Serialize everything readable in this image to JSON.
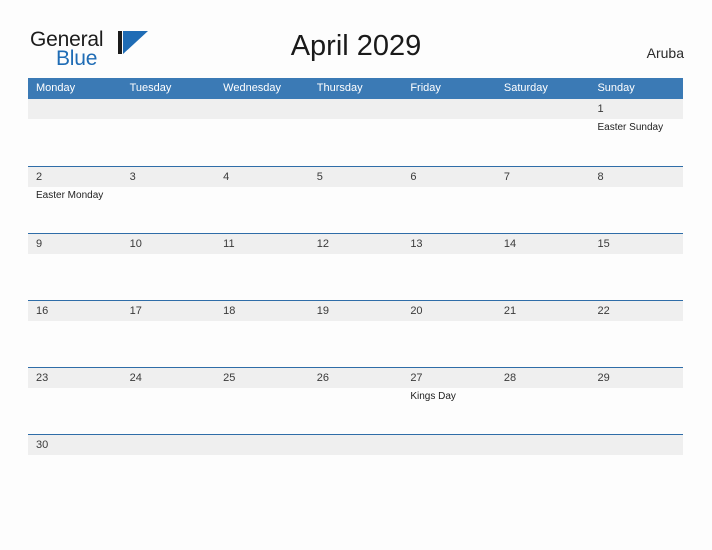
{
  "brand": {
    "word_one": "General",
    "word_two": "Blue",
    "mark_icon": "flag-triangle-icon",
    "accent_color": "#1f6cb5"
  },
  "header": {
    "title": "April 2029",
    "region": "Aruba"
  },
  "colors": {
    "header_blue": "#3b7ab5",
    "row_divider_blue": "#2f6da8",
    "date_band_gray": "#efefef",
    "page_background": "#fdfdfd"
  },
  "calendar": {
    "month": "April",
    "year": "2029",
    "weekday_headers": [
      "Monday",
      "Tuesday",
      "Wednesday",
      "Thursday",
      "Friday",
      "Saturday",
      "Sunday"
    ],
    "weeks": [
      {
        "days": [
          {
            "date": "",
            "event": ""
          },
          {
            "date": "",
            "event": ""
          },
          {
            "date": "",
            "event": ""
          },
          {
            "date": "",
            "event": ""
          },
          {
            "date": "",
            "event": ""
          },
          {
            "date": "",
            "event": ""
          },
          {
            "date": "1",
            "event": "Easter Sunday"
          }
        ]
      },
      {
        "days": [
          {
            "date": "2",
            "event": "Easter Monday"
          },
          {
            "date": "3",
            "event": ""
          },
          {
            "date": "4",
            "event": ""
          },
          {
            "date": "5",
            "event": ""
          },
          {
            "date": "6",
            "event": ""
          },
          {
            "date": "7",
            "event": ""
          },
          {
            "date": "8",
            "event": ""
          }
        ]
      },
      {
        "days": [
          {
            "date": "9",
            "event": ""
          },
          {
            "date": "10",
            "event": ""
          },
          {
            "date": "11",
            "event": ""
          },
          {
            "date": "12",
            "event": ""
          },
          {
            "date": "13",
            "event": ""
          },
          {
            "date": "14",
            "event": ""
          },
          {
            "date": "15",
            "event": ""
          }
        ]
      },
      {
        "days": [
          {
            "date": "16",
            "event": ""
          },
          {
            "date": "17",
            "event": ""
          },
          {
            "date": "18",
            "event": ""
          },
          {
            "date": "19",
            "event": ""
          },
          {
            "date": "20",
            "event": ""
          },
          {
            "date": "21",
            "event": ""
          },
          {
            "date": "22",
            "event": ""
          }
        ]
      },
      {
        "days": [
          {
            "date": "23",
            "event": ""
          },
          {
            "date": "24",
            "event": ""
          },
          {
            "date": "25",
            "event": ""
          },
          {
            "date": "26",
            "event": ""
          },
          {
            "date": "27",
            "event": "Kings Day"
          },
          {
            "date": "28",
            "event": ""
          },
          {
            "date": "29",
            "event": ""
          }
        ]
      },
      {
        "short": true,
        "days": [
          {
            "date": "30",
            "event": ""
          },
          {
            "date": "",
            "event": ""
          },
          {
            "date": "",
            "event": ""
          },
          {
            "date": "",
            "event": ""
          },
          {
            "date": "",
            "event": ""
          },
          {
            "date": "",
            "event": ""
          },
          {
            "date": "",
            "event": ""
          }
        ]
      }
    ]
  }
}
